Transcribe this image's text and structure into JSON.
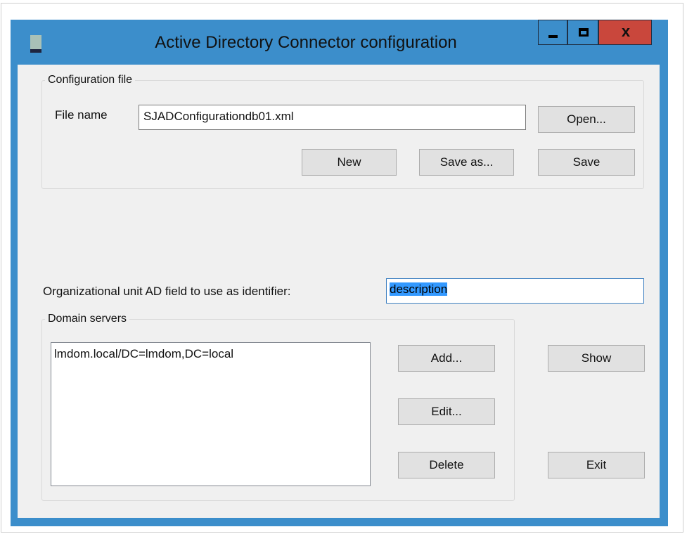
{
  "window": {
    "title": "Active Directory Connector configuration",
    "close_glyph": "x"
  },
  "config_group": {
    "legend": "Configuration file",
    "file_name_label": "File name",
    "file_name_value": "SJADConfigurationdb01.xml",
    "open_label": "Open...",
    "new_label": "New",
    "save_as_label": "Save as...",
    "save_label": "Save"
  },
  "ou_field": {
    "label": "Organizational unit AD field to use as identifier:",
    "value": "description"
  },
  "domain_group": {
    "legend": "Domain servers",
    "items": [
      "lmdom.local/DC=lmdom,DC=local"
    ],
    "add_label": "Add...",
    "edit_label": "Edit...",
    "delete_label": "Delete"
  },
  "actions": {
    "show_label": "Show",
    "exit_label": "Exit"
  }
}
